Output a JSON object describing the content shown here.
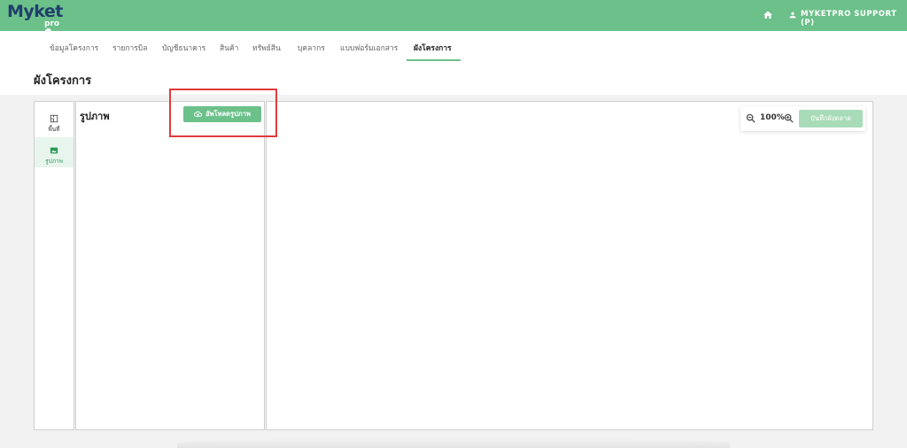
{
  "app": {
    "logo_main": "Myket",
    "logo_sub": "pro",
    "user_name": "MYKETPRO SUPPORT (P)",
    "accent_color": "#6cc08a"
  },
  "tabs": [
    {
      "label": "ข้อมูลโครงการ",
      "active": false
    },
    {
      "label": "รายการบิล",
      "active": false
    },
    {
      "label": "บัญชีธนาคาร",
      "active": false
    },
    {
      "label": "สินค้า",
      "active": false
    },
    {
      "label": "ทรัพย์สิน",
      "active": false
    },
    {
      "label": "บุคลากร",
      "active": false
    },
    {
      "label": "แบบฟอร์มเอกสาร",
      "active": false
    },
    {
      "label": "ผังโครงการ",
      "active": true
    }
  ],
  "page": {
    "title": "ผังโครงการ"
  },
  "tools": {
    "area_label": "พื้นที่",
    "image_label": "รูปภาพ"
  },
  "images_panel": {
    "title": "รูปภาพ",
    "upload_label": "อัพโหลดรูปภาพ"
  },
  "zoom": {
    "level": "100%",
    "save_label": "บันทึกผังตลาด"
  }
}
